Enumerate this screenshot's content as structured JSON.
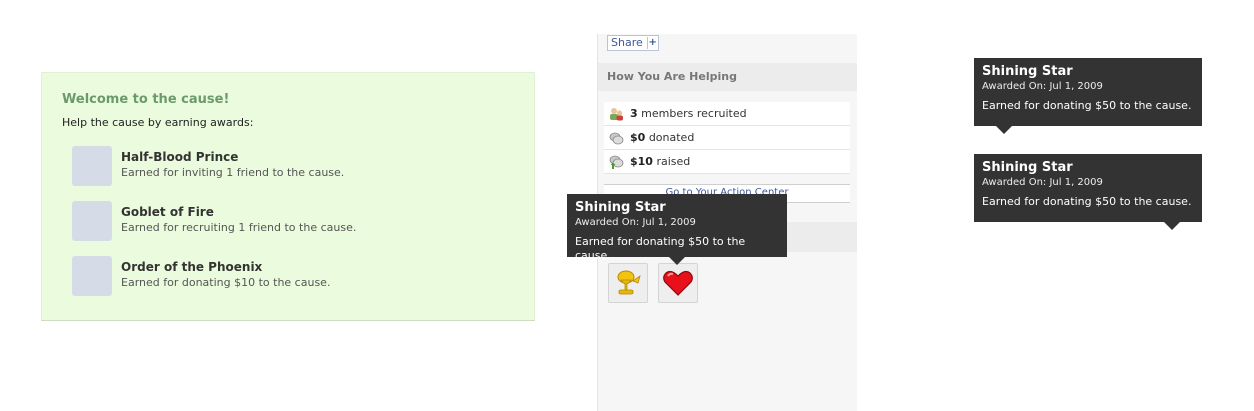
{
  "welcome": {
    "title": "Welcome to the cause!",
    "subtitle": "Help the cause by earning awards:",
    "awards": [
      {
        "name": "Half-Blood Prince",
        "desc": "Earned for inviting 1 friend to the cause."
      },
      {
        "name": "Goblet of Fire",
        "desc": "Earned for recruiting 1 friend to the cause."
      },
      {
        "name": "Order of the Phoenix",
        "desc": "Earned for donating $10 to the cause."
      }
    ]
  },
  "sidebar": {
    "share_label": "Share",
    "share_plus": "+",
    "section_title": "How You Are Helping",
    "stats": [
      {
        "value": "3",
        "label": "members recruited",
        "icon": "members-icon"
      },
      {
        "value": "$0",
        "label": "donated",
        "icon": "coins-icon"
      },
      {
        "value": "$10",
        "label": "raised",
        "icon": "coins-arrow-icon"
      }
    ],
    "action_link": "Go to Your Action Center",
    "badges": [
      {
        "icon": "gold-trophy-icon"
      },
      {
        "icon": "heart-icon"
      }
    ]
  },
  "tooltip": {
    "title": "Shining Star",
    "date": "Awarded On: Jul 1, 2009",
    "text": "Earned for donating $50 to the cause."
  },
  "colors": {
    "tooltip_bg": "#333333",
    "welcome_bg": "#ebfbdd",
    "welcome_title": "#6b9a6b",
    "link": "#3b5998",
    "heart": "#e8101a",
    "trophy": "#e5b80b"
  }
}
